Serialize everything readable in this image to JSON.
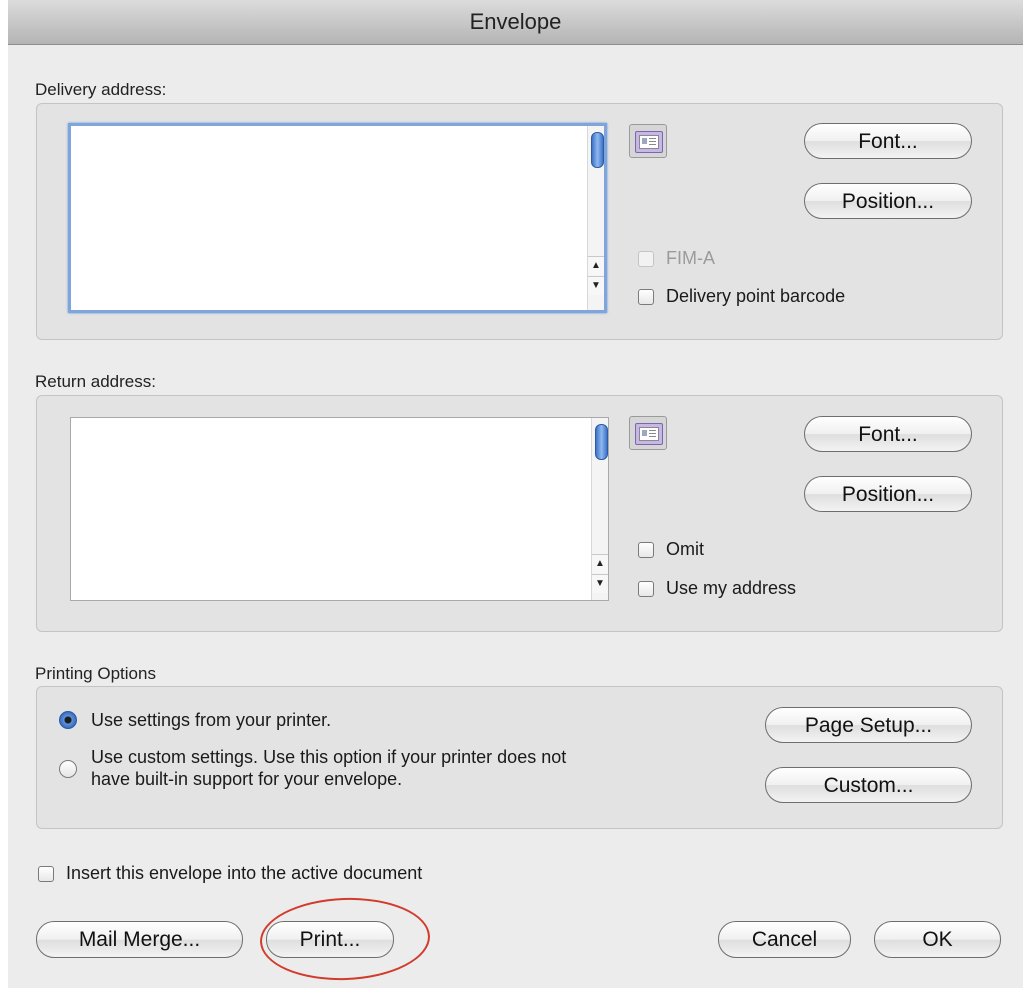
{
  "window": {
    "title": "Envelope"
  },
  "delivery": {
    "label": "Delivery address:",
    "address_value": "",
    "address_book_icon": "address-book-icon",
    "font_button": "Font...",
    "position_button": "Position...",
    "fim_a_label": "FIM-A",
    "fim_a_checked": false,
    "fim_a_enabled": false,
    "barcode_label": "Delivery point barcode",
    "barcode_checked": false
  },
  "return": {
    "label": "Return address:",
    "address_value": "",
    "address_book_icon": "address-book-icon",
    "font_button": "Font...",
    "position_button": "Position...",
    "omit_label": "Omit",
    "omit_checked": false,
    "use_my_address_label": "Use my address",
    "use_my_address_checked": false
  },
  "printing": {
    "label": "Printing Options",
    "option1": "Use settings from your printer.",
    "option2_line1": "Use custom settings. Use this option if your printer does not",
    "option2_line2": "have built-in support for your envelope.",
    "selected_option": 1,
    "page_setup_button": "Page Setup...",
    "custom_button": "Custom..."
  },
  "insert_envelope": {
    "label": "Insert this envelope into the active document",
    "checked": false
  },
  "footer": {
    "mail_merge_button": "Mail Merge...",
    "print_button": "Print...",
    "cancel_button": "Cancel",
    "ok_button": "OK"
  },
  "colors": {
    "annotation": "#d23b2b",
    "focus_ring": "#7ea6dd",
    "radio_selected": "#2f64b8"
  }
}
